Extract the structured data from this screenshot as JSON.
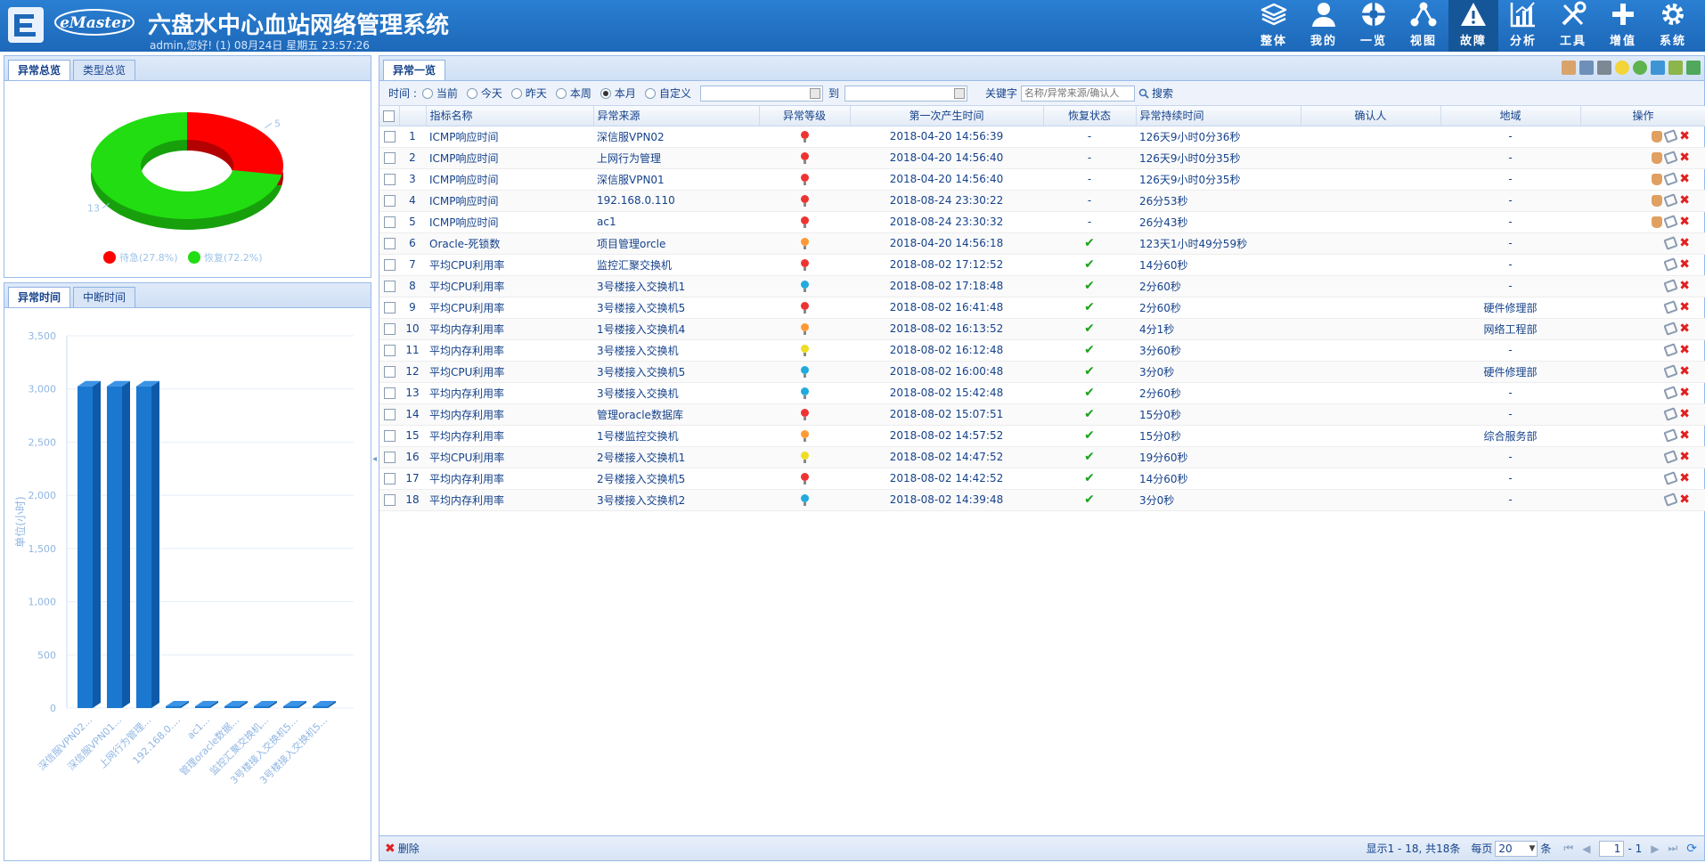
{
  "header": {
    "brand": "eMaster",
    "title": "六盘水中心血站网络管理系统",
    "subinfo": "admin,您好! (1) 08月24日 星期五 23:57:26",
    "nav": [
      {
        "label": "整体",
        "icon": "layers-icon"
      },
      {
        "label": "我的",
        "icon": "user-icon"
      },
      {
        "label": "一览",
        "icon": "overview-icon"
      },
      {
        "label": "视图",
        "icon": "topology-icon"
      },
      {
        "label": "故障",
        "icon": "warning-icon"
      },
      {
        "label": "分析",
        "icon": "analysis-icon"
      },
      {
        "label": "工具",
        "icon": "tools-icon"
      },
      {
        "label": "增值",
        "icon": "plus-icon"
      },
      {
        "label": "系统",
        "icon": "gear-icon"
      }
    ],
    "active_nav": "故障"
  },
  "left": {
    "top_tabs": [
      "异常总览",
      "类型总览"
    ],
    "bottom_tabs": [
      "异常时间",
      "中断时间"
    ]
  },
  "chart_data": [
    {
      "type": "pie",
      "labels": [
        "待急",
        "恢复"
      ],
      "values": [
        5,
        13
      ],
      "value_labels": [
        "5",
        "13"
      ],
      "legend": [
        "待急(27.8%)",
        "恢复(72.2%)"
      ],
      "colors": [
        "#ff0000",
        "#22dd11"
      ],
      "legend_position": "bottom"
    },
    {
      "type": "bar",
      "categories": [
        "深信服VPN02...",
        "深信服VPN01...",
        "上网行为管理...",
        "192.168.0....",
        "ac1...",
        "管理oracle数据...",
        "监控汇聚交换机...",
        "3号楼接入交换机5...",
        "3号楼接入交换机5..."
      ],
      "values": [
        3025,
        3025,
        3025,
        0.7,
        0.7,
        0.3,
        0.23,
        0.05,
        0.05
      ],
      "ylabel": "单位(小时)",
      "ylim": [
        0,
        3500
      ],
      "yticks": [
        "0",
        "500",
        "1,000",
        "1,500",
        "2,000",
        "2,500",
        "3,000",
        "3,500"
      ],
      "grid": true,
      "color": "#1a78d0"
    }
  ],
  "main": {
    "tab": "异常一览",
    "filter": {
      "time_label": "时间 :",
      "options": [
        "当前",
        "今天",
        "昨天",
        "本周",
        "本月",
        "自定义"
      ],
      "selected": "本月",
      "to_label": "到",
      "keyword_label": "关键字",
      "keyword_placeholder": "名称/异常来源/确认人",
      "search_label": "搜索"
    },
    "columns": [
      "指标名称",
      "异常来源",
      "异常等级",
      "第一次产生时间",
      "恢复状态",
      "异常持续时间",
      "确认人",
      "地域",
      "操作"
    ],
    "rows": [
      {
        "no": "1",
        "name": "ICMP响应时间",
        "source": "深信服VPN02",
        "level": "#ee3333",
        "time": "2018-04-20 14:56:39",
        "status": "-",
        "duration": "126天9小时0分36秒",
        "confirm": "",
        "region": "-",
        "hand": true
      },
      {
        "no": "2",
        "name": "ICMP响应时间",
        "source": "上网行为管理",
        "level": "#ee3333",
        "time": "2018-04-20 14:56:40",
        "status": "-",
        "duration": "126天9小时0分35秒",
        "confirm": "",
        "region": "-",
        "hand": true
      },
      {
        "no": "3",
        "name": "ICMP响应时间",
        "source": "深信服VPN01",
        "level": "#ee3333",
        "time": "2018-04-20 14:56:40",
        "status": "-",
        "duration": "126天9小时0分35秒",
        "confirm": "",
        "region": "-",
        "hand": true
      },
      {
        "no": "4",
        "name": "ICMP响应时间",
        "source": "192.168.0.110",
        "level": "#ee3333",
        "time": "2018-08-24 23:30:22",
        "status": "-",
        "duration": "26分53秒",
        "confirm": "",
        "region": "-",
        "hand": true
      },
      {
        "no": "5",
        "name": "ICMP响应时间",
        "source": "ac1",
        "level": "#ee3333",
        "time": "2018-08-24 23:30:32",
        "status": "-",
        "duration": "26分43秒",
        "confirm": "",
        "region": "-",
        "hand": true
      },
      {
        "no": "6",
        "name": "Oracle-死锁数",
        "source": "项目管理orcle",
        "level": "#ff9933",
        "time": "2018-04-20 14:56:18",
        "status": "ok",
        "duration": "123天1小时49分59秒",
        "confirm": "",
        "region": "-",
        "hand": false
      },
      {
        "no": "7",
        "name": "平均CPU利用率",
        "source": "监控汇聚交换机",
        "level": "#ee3333",
        "time": "2018-08-02 17:12:52",
        "status": "ok",
        "duration": "14分60秒",
        "confirm": "",
        "region": "-",
        "hand": false
      },
      {
        "no": "8",
        "name": "平均CPU利用率",
        "source": "3号楼接入交换机1",
        "level": "#22aadd",
        "time": "2018-08-02 17:18:48",
        "status": "ok",
        "duration": "2分60秒",
        "confirm": "",
        "region": "-",
        "hand": false
      },
      {
        "no": "9",
        "name": "平均CPU利用率",
        "source": "3号楼接入交换机5",
        "level": "#ee3333",
        "time": "2018-08-02 16:41:48",
        "status": "ok",
        "duration": "2分60秒",
        "confirm": "",
        "region": "硬件修理部",
        "hand": false
      },
      {
        "no": "10",
        "name": "平均内存利用率",
        "source": "1号楼接入交换机4",
        "level": "#ff9933",
        "time": "2018-08-02 16:13:52",
        "status": "ok",
        "duration": "4分1秒",
        "confirm": "",
        "region": "网络工程部",
        "hand": false
      },
      {
        "no": "11",
        "name": "平均内存利用率",
        "source": "3号楼接入交换机",
        "level": "#eedd22",
        "time": "2018-08-02 16:12:48",
        "status": "ok",
        "duration": "3分60秒",
        "confirm": "",
        "region": "-",
        "hand": false
      },
      {
        "no": "12",
        "name": "平均CPU利用率",
        "source": "3号楼接入交换机5",
        "level": "#22aadd",
        "time": "2018-08-02 16:00:48",
        "status": "ok",
        "duration": "3分0秒",
        "confirm": "",
        "region": "硬件修理部",
        "hand": false
      },
      {
        "no": "13",
        "name": "平均内存利用率",
        "source": "3号楼接入交换机",
        "level": "#22aadd",
        "time": "2018-08-02 15:42:48",
        "status": "ok",
        "duration": "2分60秒",
        "confirm": "",
        "region": "-",
        "hand": false
      },
      {
        "no": "14",
        "name": "平均内存利用率",
        "source": "管理oracle数据库",
        "level": "#ee3333",
        "time": "2018-08-02 15:07:51",
        "status": "ok",
        "duration": "15分0秒",
        "confirm": "",
        "region": "-",
        "hand": false
      },
      {
        "no": "15",
        "name": "平均内存利用率",
        "source": "1号楼监控交换机",
        "level": "#ff9933",
        "time": "2018-08-02 14:57:52",
        "status": "ok",
        "duration": "15分0秒",
        "confirm": "",
        "region": "综合服务部",
        "hand": false
      },
      {
        "no": "16",
        "name": "平均CPU利用率",
        "source": "2号楼接入交换机1",
        "level": "#eedd22",
        "time": "2018-08-02 14:47:52",
        "status": "ok",
        "duration": "19分60秒",
        "confirm": "",
        "region": "-",
        "hand": false
      },
      {
        "no": "17",
        "name": "平均内存利用率",
        "source": "2号楼接入交换机5",
        "level": "#ee3333",
        "time": "2018-08-02 14:42:52",
        "status": "ok",
        "duration": "14分60秒",
        "confirm": "",
        "region": "-",
        "hand": false
      },
      {
        "no": "18",
        "name": "平均内存利用率",
        "source": "3号楼接入交换机2",
        "level": "#22aadd",
        "time": "2018-08-02 14:39:48",
        "status": "ok",
        "duration": "3分0秒",
        "confirm": "",
        "region": "-",
        "hand": false
      }
    ],
    "footer": {
      "delete_label": "删除",
      "summary": "显示1 - 18, 共18条",
      "per_page_label": "每页",
      "per_page": "20",
      "unit": "条",
      "page": "1",
      "page_total": "- 1"
    }
  }
}
